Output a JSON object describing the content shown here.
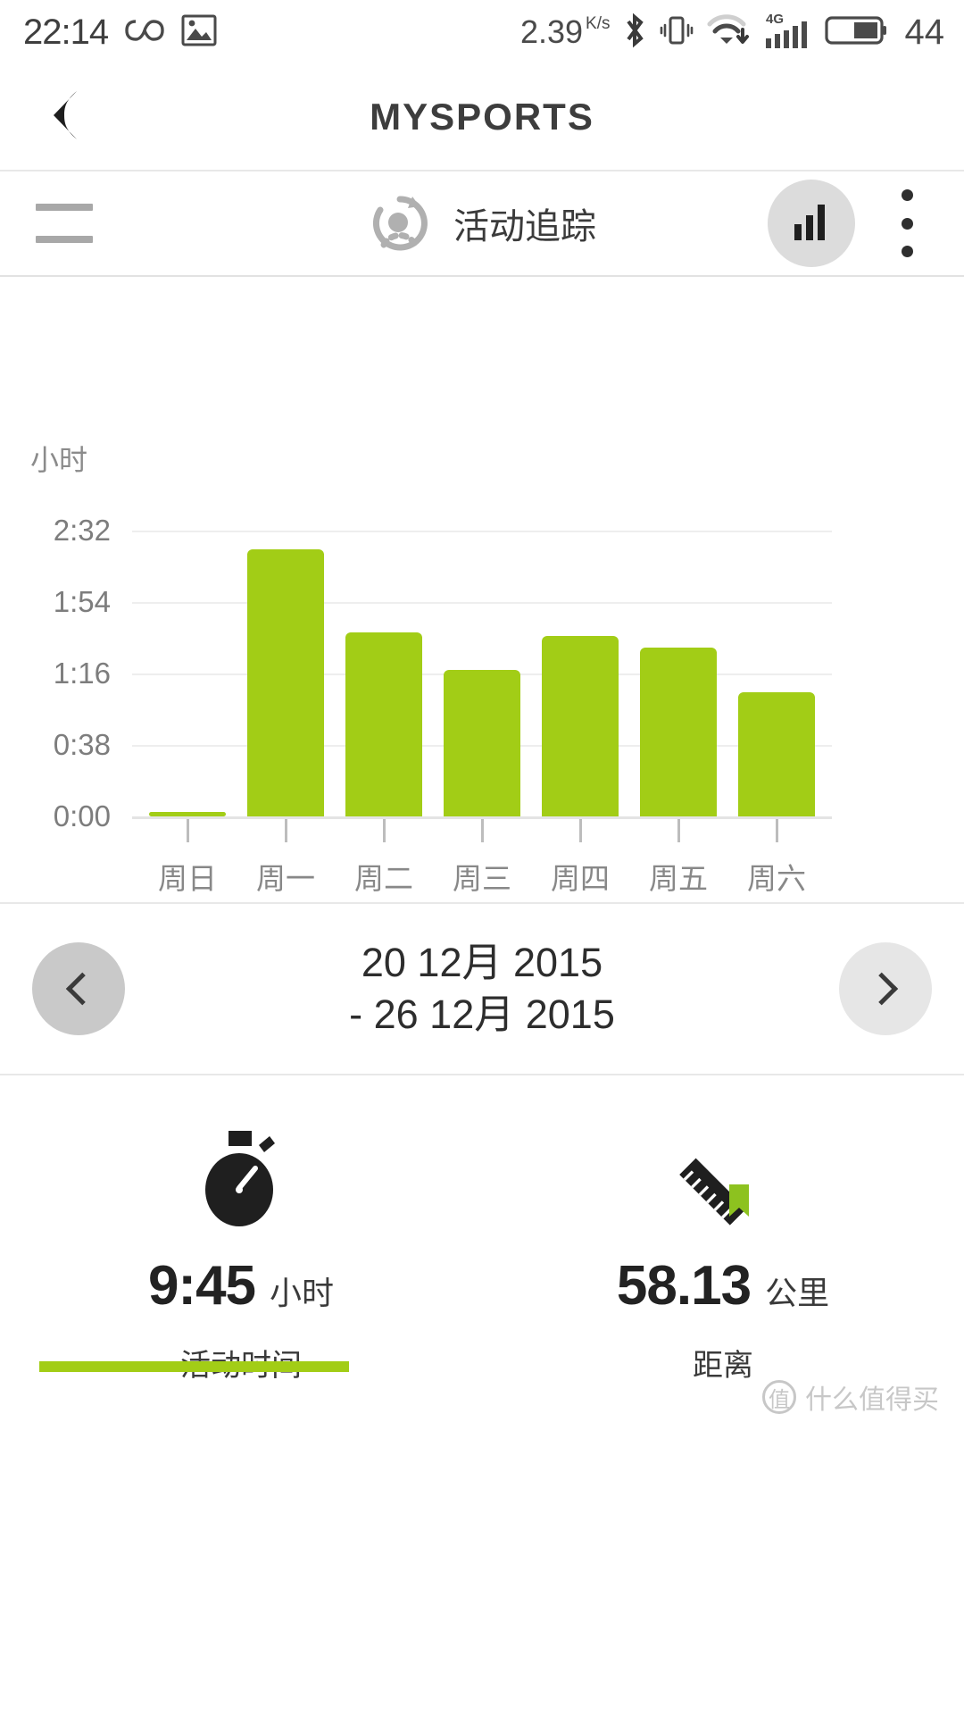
{
  "statusbar": {
    "clock": "22:14",
    "icons_left": [
      "infinity-icon",
      "image-icon"
    ],
    "network_speed": "2.39",
    "network_speed_unit": "K/s",
    "icons_right": [
      "bluetooth-icon",
      "vibrate-icon",
      "wifi-download-icon",
      "signal-4g-icon",
      "battery-icon"
    ],
    "signal_label": "4G",
    "battery_percent": "44"
  },
  "titlebar": {
    "back_icon": "back-arrow-icon",
    "title": "MYSPORTS"
  },
  "toolbar": {
    "menu_icon": "hamburger-menu-icon",
    "activity_icon": "activity-tracking-icon",
    "title": "活动追踪",
    "chart_toggle_icon": "bar-chart-icon",
    "overflow_icon": "more-options-icon"
  },
  "chart_data": {
    "type": "bar",
    "title": "",
    "ylabel": "小时",
    "xlabel": "",
    "categories": [
      "周日",
      "周一",
      "周二",
      "周三",
      "周四",
      "周五",
      "周六"
    ],
    "values": [
      0.0,
      2.37,
      1.63,
      1.3,
      1.6,
      1.5,
      1.1
    ],
    "value_labels": [
      "0:00",
      "2:22",
      "1:38",
      "1:18",
      "1:36",
      "1:30",
      "1:06"
    ],
    "ytick_labels": [
      "0:00",
      "0:38",
      "1:16",
      "1:54",
      "2:32"
    ],
    "ytick_values": [
      0,
      0.6333,
      1.2667,
      1.9,
      2.5333
    ],
    "ylim": [
      0,
      2.5333
    ],
    "grid": true,
    "legend": "none",
    "bar_color": "#a2cd16",
    "grid_color": "#eeeeee"
  },
  "datenav": {
    "prev_icon": "chevron-left-icon",
    "next_icon": "chevron-right-icon",
    "range_line1": "20 12月 2015",
    "range_line2": "- 26 12月 2015"
  },
  "stats": [
    {
      "icon": "stopwatch-icon",
      "value": "9:45",
      "unit": "小时",
      "label": "活动时间"
    },
    {
      "icon": "ruler-icon",
      "value": "58.13",
      "unit": "公里",
      "label": "距离"
    }
  ],
  "progress": {
    "fill_percent": 35,
    "color": "#a2cd16"
  },
  "watermark": {
    "mark": "值",
    "text": "什么值得买"
  }
}
